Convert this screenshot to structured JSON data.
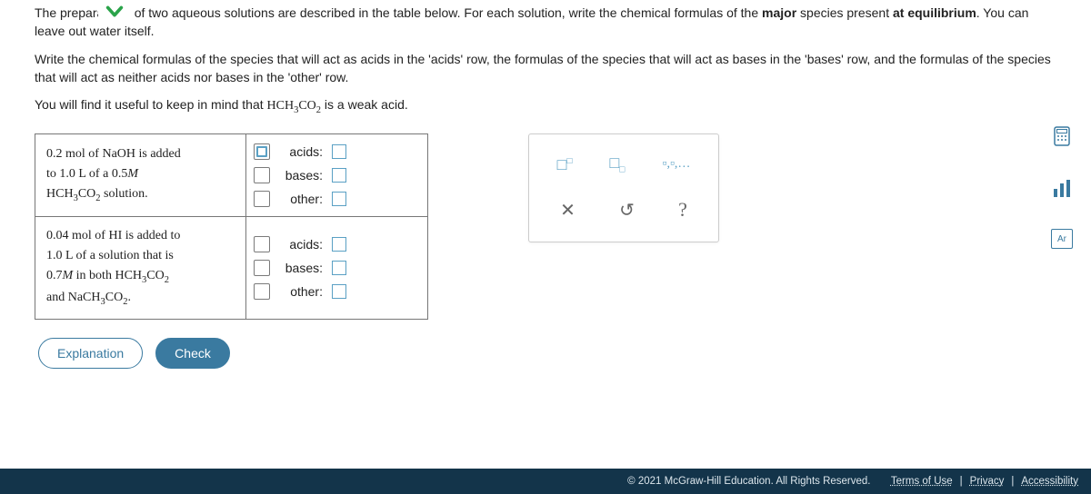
{
  "instructions": {
    "p1_a": "The preparations of two aqueous solutions are described in the table below. For each solution, write the chemical formulas of the ",
    "p1_b": "major",
    "p1_c": " species present ",
    "p1_d": "at equilibrium",
    "p1_e": ". You can leave out water itself.",
    "p2": "Write the chemical formulas of the species that will act as acids in the 'acids' row, the formulas of the species that will act as bases in the 'bases' row, and the formulas of the species that will act as neither acids nor bases in the 'other' row.",
    "p3_a": "You will find it useful to keep in mind that ",
    "p3_formula": "HCH₃CO₂",
    "p3_b": " is a weak acid."
  },
  "rows": {
    "labels": {
      "acids": "acids:",
      "bases": "bases:",
      "other": "other:"
    },
    "r1": {
      "l1a": "0.2",
      "l1b": " mol of ",
      "l1c": "NaOH",
      "l1d": " is added",
      "l2a": "to ",
      "l2b": "1.0",
      "l2c": " L of a ",
      "l2d": "0.5",
      "l2e": "M",
      "l3a": "HCH₃CO₂",
      "l3b": " solution."
    },
    "r2": {
      "l1a": "0.04",
      "l1b": " mol of ",
      "l1c": "HI",
      "l1d": " is added to",
      "l2a": "1.0",
      "l2b": " L of a solution that is",
      "l3a": "0.7",
      "l3b": "M",
      "l3c": " in both ",
      "l3d": "HCH₃CO₂",
      "l4a": "and ",
      "l4b": "NaCH₃CO₂",
      "l4c": "."
    }
  },
  "palette": {
    "sup": "▫",
    "sub": "▫",
    "list": "▫,▫,…"
  },
  "controls": {
    "cancel": "✕",
    "reset": "↺",
    "help": "?"
  },
  "buttons": {
    "explanation": "Explanation",
    "check": "Check"
  },
  "sideicons": {
    "calc": "calculator",
    "chart": "bar-chart",
    "pt": "Ar"
  },
  "footer": {
    "copyright": "© 2021 McGraw-Hill Education. All Rights Reserved.",
    "terms": "Terms of Use",
    "privacy": "Privacy",
    "access": "Accessibility",
    "sep": "|"
  }
}
